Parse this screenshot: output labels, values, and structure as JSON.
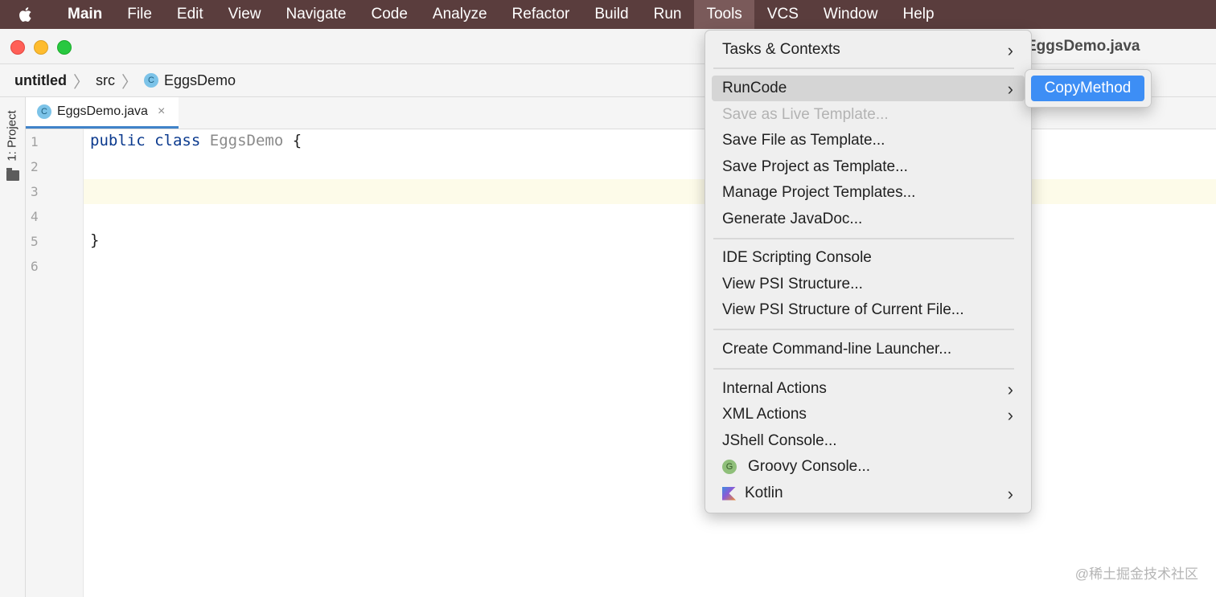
{
  "menubar": {
    "items": [
      "Main",
      "File",
      "Edit",
      "View",
      "Navigate",
      "Code",
      "Analyze",
      "Refactor",
      "Build",
      "Run",
      "Tools",
      "VCS",
      "Window",
      "Help"
    ],
    "active": "Tools"
  },
  "window": {
    "title": "EggsDemo.java"
  },
  "breadcrumb": {
    "project": "untitled",
    "folder": "src",
    "file": "EggsDemo",
    "file_icon_letter": "C"
  },
  "project_tool": {
    "label": "1: Project"
  },
  "editor": {
    "tab_label": "EggsDemo.java",
    "tab_icon_letter": "C",
    "close_glyph": "×",
    "line_numbers": [
      "1",
      "2",
      "3",
      "4",
      "5",
      "6"
    ],
    "line1": {
      "kw1": "public",
      "kw2": "class",
      "class_name": "EggsDemo",
      "brace": "{"
    },
    "line5": {
      "brace": "}"
    }
  },
  "tools_menu": {
    "tasks": "Tasks & Contexts",
    "runcode": "RunCode",
    "save_live": "Save as Live Template...",
    "save_file": "Save File as Template...",
    "save_project": "Save Project as Template...",
    "manage": "Manage Project Templates...",
    "javadoc": "Generate JavaDoc...",
    "ide_console": "IDE Scripting Console",
    "psi": "View PSI Structure...",
    "psi_current": "View PSI Structure of Current File...",
    "launcher": "Create Command-line Launcher...",
    "internal": "Internal Actions",
    "xml": "XML Actions",
    "jshell": "JShell Console...",
    "groovy": "Groovy Console...",
    "groovy_icon_letter": "G",
    "kotlin": "Kotlin",
    "submenu_arrow": "›"
  },
  "submenu": {
    "copy_method": "CopyMethod"
  },
  "watermark": "@稀土掘金技术社区",
  "colors": {
    "menubar": "#5a3d3d",
    "highlight": "#3d8ef5",
    "caret_line": "#fdfbe9",
    "keyword": "#0b3a8e"
  }
}
